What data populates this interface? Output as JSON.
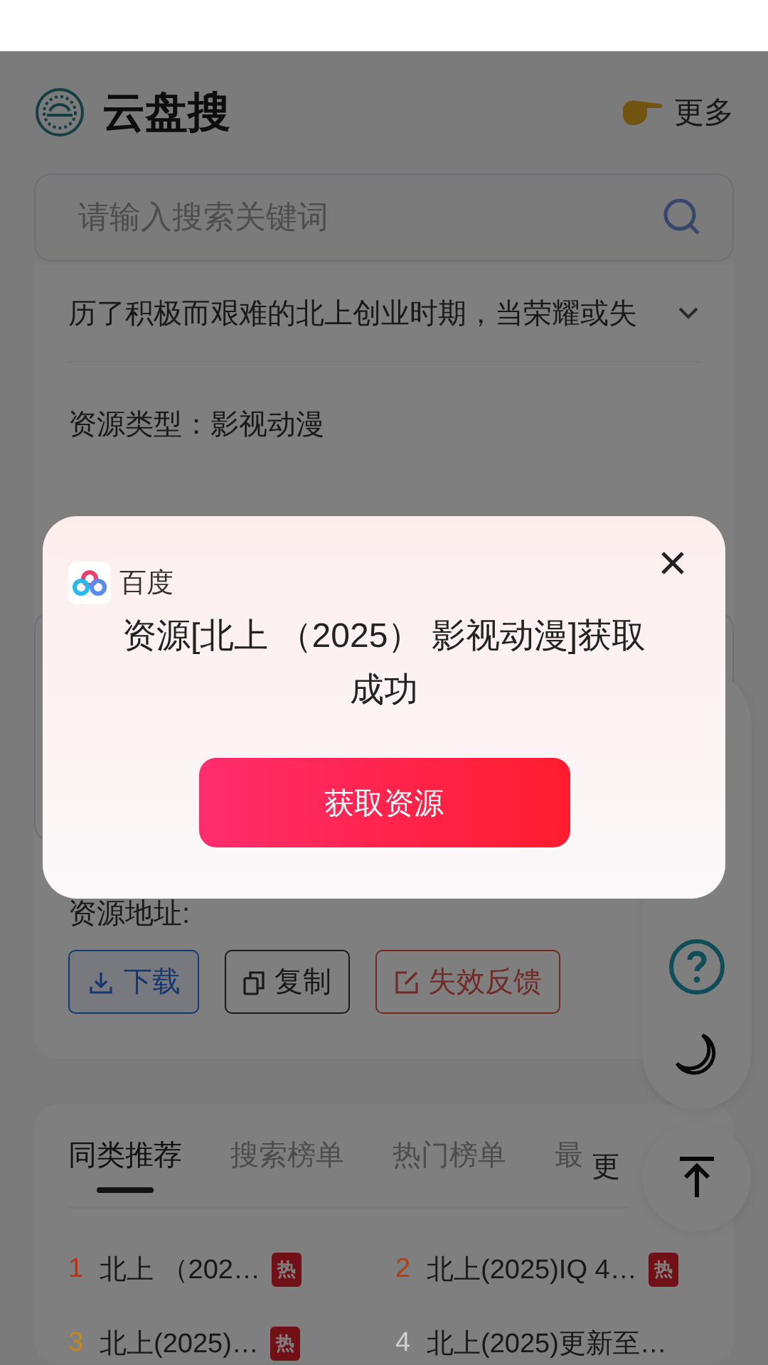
{
  "header": {
    "title": "云盘搜",
    "more": "更多"
  },
  "search": {
    "placeholder": "请输入搜索关键词"
  },
  "detail": {
    "description": "历了积极而艰难的北上创业时期，当荣耀或失",
    "expanded": false,
    "type_label": "资源类型：",
    "type_value": "影视动漫",
    "address_label": "资源地址:",
    "actions": [
      {
        "kind": "download",
        "label": "下载"
      },
      {
        "kind": "copy",
        "label": "复制"
      },
      {
        "kind": "report",
        "label": "失效反馈"
      }
    ]
  },
  "rank": {
    "tabs": [
      {
        "label": "同类推荐",
        "selected": true
      },
      {
        "label": "搜索榜单",
        "selected": false
      },
      {
        "label": "热门榜单",
        "selected": false
      },
      {
        "label": "最",
        "selected": false
      }
    ],
    "more": "更",
    "items": [
      {
        "rank": "1",
        "title": "北上 （202…",
        "hot": true,
        "badge": "热",
        "color": "#b83218"
      },
      {
        "rank": "2",
        "title": "北上(2025)IQ 4…",
        "hot": true,
        "badge": "热",
        "color": "#b0400c"
      },
      {
        "rank": "3",
        "title": "北上(2025)…",
        "hot": true,
        "badge": "热",
        "color": "#c8861a"
      },
      {
        "rank": "4",
        "title": "北上(2025)更新至…",
        "hot": false,
        "color": "#d0d0d0"
      }
    ]
  },
  "dialog": {
    "source": "百度",
    "message": "资源[北上 （2025） 影视动漫]获取成功",
    "button": "获取资源"
  }
}
